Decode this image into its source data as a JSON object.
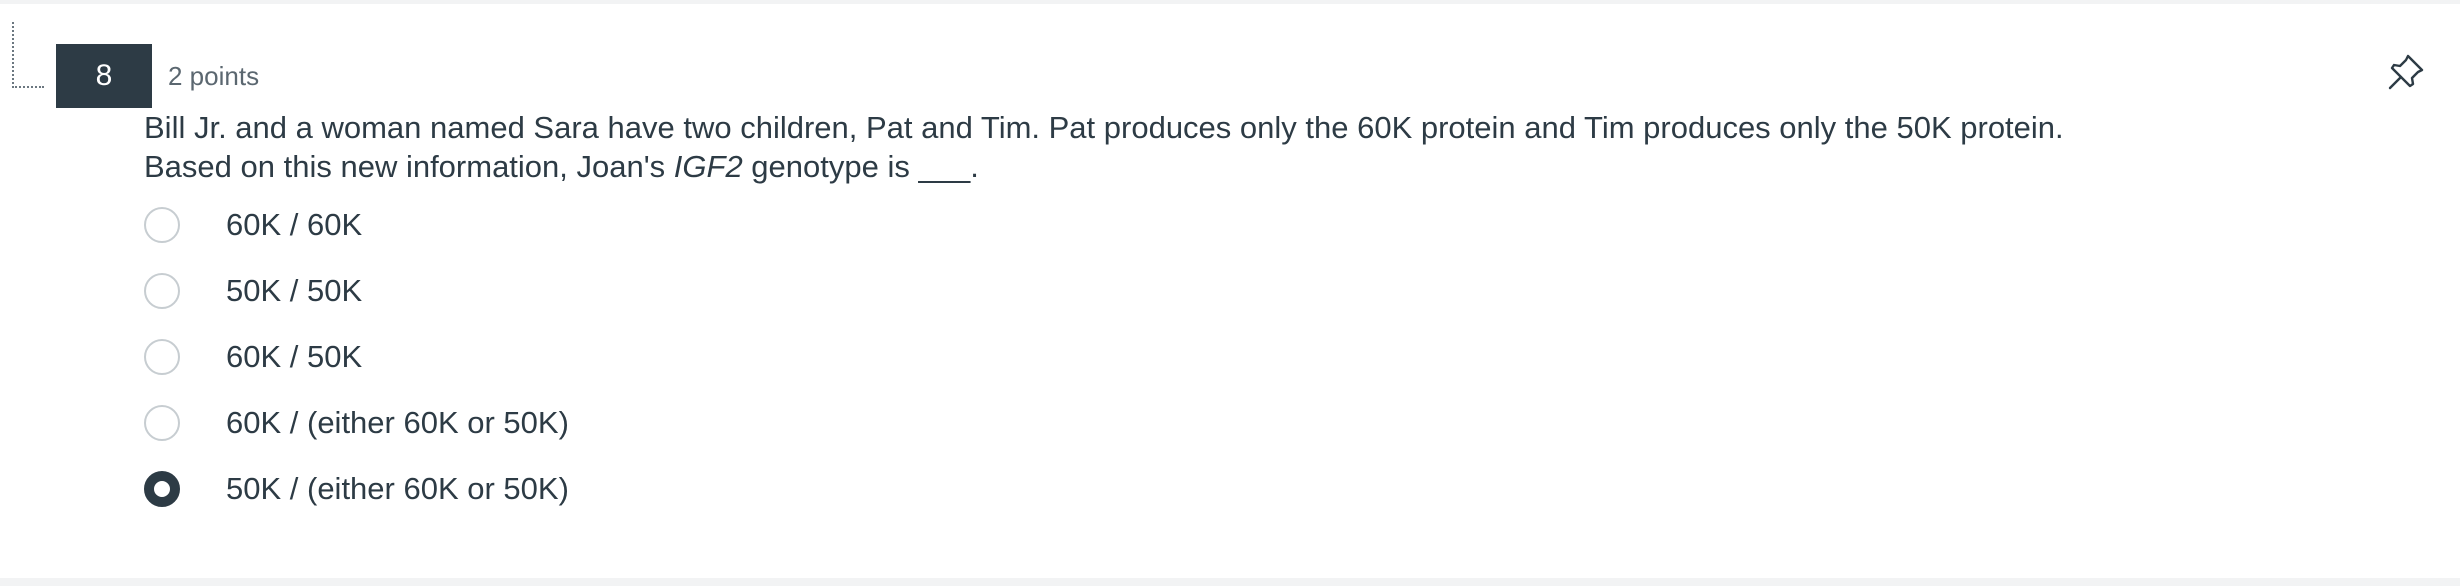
{
  "question": {
    "number": "8",
    "points": "2 points",
    "text_line1": "Bill Jr. and a woman named Sara have two children, Pat and Tim. Pat produces only the 60K protein and Tim produces only the 50K protein.",
    "text_line2_before": "Based on this new information, Joan's ",
    "text_line2_gene": "IGF2",
    "text_line2_after": " genotype is ___.",
    "pin_icon": "pushpin-icon"
  },
  "answers": [
    {
      "label": "60K / 60K",
      "selected": false
    },
    {
      "label": "50K / 50K",
      "selected": false
    },
    {
      "label": "60K / 50K",
      "selected": false
    },
    {
      "label": "60K / (either 60K or 50K)",
      "selected": false
    },
    {
      "label": "50K / (either 60K or 50K)",
      "selected": true
    }
  ],
  "colors": {
    "number_badge_bg": "#2d3b45",
    "text": "#2d3b45",
    "radio_border": "#c7cdd1",
    "radio_selected": "#2d3b45"
  }
}
